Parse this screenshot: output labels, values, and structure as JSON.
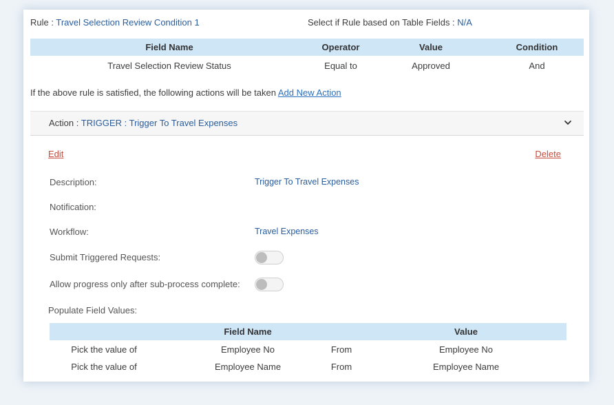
{
  "rule": {
    "label": "Rule :",
    "name": "Travel Selection Review Condition 1",
    "table_fields_label": "Select if Rule based on Table Fields :",
    "table_fields_value": "N/A"
  },
  "rule_table": {
    "headers": {
      "field_name": "Field Name",
      "operator": "Operator",
      "value": "Value",
      "condition": "Condition"
    },
    "rows": [
      {
        "field_name": "Travel Selection Review Status",
        "operator": "Equal to",
        "value": "Approved",
        "condition": "And"
      }
    ]
  },
  "actions_intro": {
    "text": "If the above rule is satisfied, the following actions will be taken",
    "add_link": "Add New Action"
  },
  "action": {
    "label": "Action :",
    "type": "TRIGGER",
    "separator": ":",
    "name": "Trigger To Travel Expenses",
    "edit_label": "Edit",
    "delete_label": "Delete",
    "fields": {
      "description_label": "Description:",
      "description_value": "Trigger To Travel Expenses",
      "notification_label": "Notification:",
      "workflow_label": "Workflow:",
      "workflow_value": "Travel Expenses",
      "submit_label": "Submit Triggered Requests:",
      "submit_on": false,
      "progress_label": "Allow progress only after sub-process complete:",
      "progress_on": false,
      "populate_label": "Populate Field Values:"
    }
  },
  "populate_table": {
    "headers": {
      "field_name": "Field Name",
      "value": "Value"
    },
    "rows": [
      {
        "action": "Pick the value of",
        "field": "Employee No",
        "from": "From",
        "value": "Employee No"
      },
      {
        "action": "Pick the value of",
        "field": "Employee Name",
        "from": "From",
        "value": "Employee Name"
      }
    ]
  },
  "icons": {
    "collapse": "chevron-down-icon"
  },
  "colors": {
    "header_bg": "#cfe6f7",
    "link_blue": "#2a6fc0",
    "value_blue": "#2a5d9c",
    "danger": "#c84b3c"
  }
}
